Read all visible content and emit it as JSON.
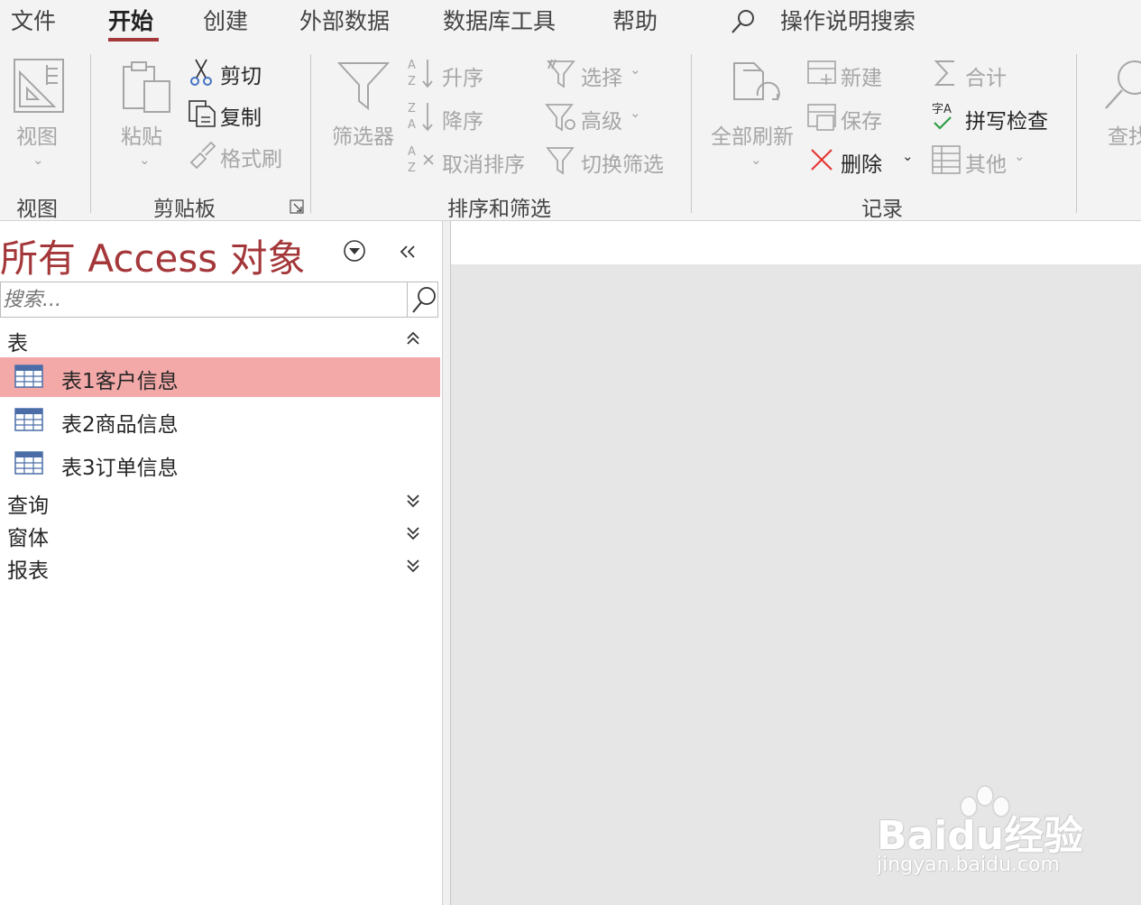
{
  "tabs": [
    {
      "label": "文件",
      "active": false
    },
    {
      "label": "开始",
      "active": true
    },
    {
      "label": "创建",
      "active": false
    },
    {
      "label": "外部数据",
      "active": false
    },
    {
      "label": "数据库工具",
      "active": false
    },
    {
      "label": "帮助",
      "active": false
    }
  ],
  "tell_me": "操作说明搜索",
  "groups": {
    "view": {
      "label": "视图",
      "button": "视图"
    },
    "clipboard": {
      "label": "剪贴板",
      "paste": "粘贴",
      "cut": "剪切",
      "copy": "复制",
      "format_painter": "格式刷"
    },
    "sort_filter": {
      "label": "排序和筛选",
      "filter": "筛选器",
      "ascending": "升序",
      "descending": "降序",
      "remove_sort": "取消排序",
      "selection": "选择",
      "advanced": "高级",
      "toggle_filter": "切换筛选"
    },
    "records": {
      "label": "记录",
      "refresh_all": "全部刷新",
      "new": "新建",
      "save": "保存",
      "delete": "删除",
      "totals": "合计",
      "spelling": "拼写检查",
      "more": "其他"
    },
    "find": {
      "label": "查找"
    }
  },
  "nav": {
    "title": "所有 Access 对象",
    "search_placeholder": "搜索...",
    "categories": {
      "tables": "表",
      "queries": "查询",
      "forms": "窗体",
      "reports": "报表"
    },
    "tables": [
      {
        "label": "表1客户信息",
        "selected": true
      },
      {
        "label": "表2商品信息",
        "selected": false
      },
      {
        "label": "表3订单信息",
        "selected": false
      }
    ]
  },
  "watermark": {
    "brand": "Baidu经验",
    "url": "jingyan.baidu.com"
  },
  "colors": {
    "accent": "#a4373a",
    "selection": "#f4a9a9",
    "disabled": "#a6a6a6"
  }
}
